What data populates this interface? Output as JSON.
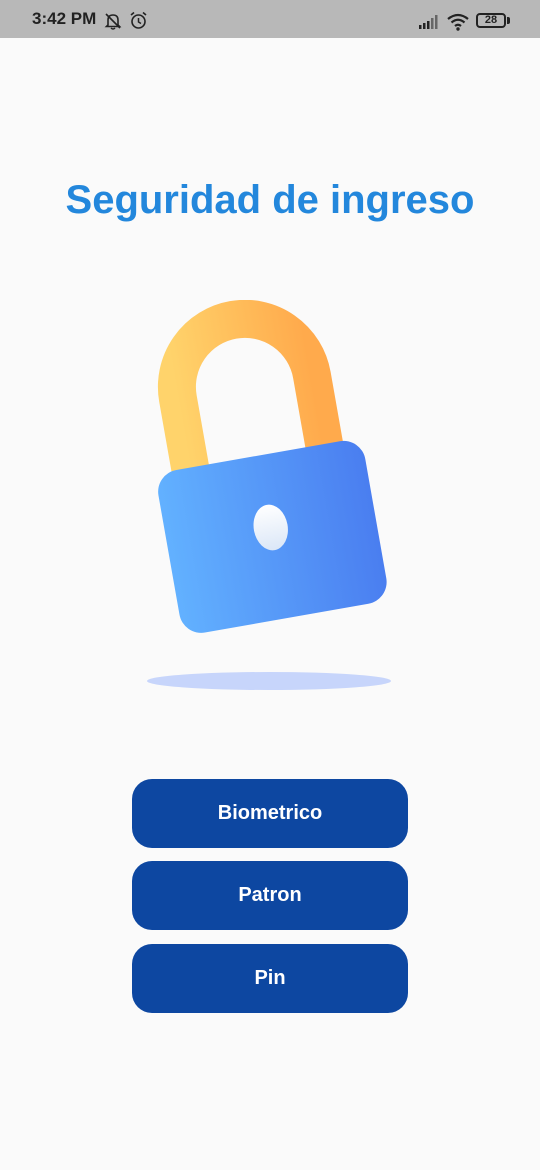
{
  "status_bar": {
    "time": "3:42 PM",
    "battery": "28",
    "icons": [
      "notifications-off-icon",
      "alarm-icon",
      "signal-icon",
      "wifi-icon",
      "battery-icon"
    ]
  },
  "title": "Seguridad de ingreso",
  "illustration": {
    "icon": "padlock-icon",
    "colors": {
      "shackle": [
        "#ffd36b",
        "#ffaa4c"
      ],
      "body": [
        "#62b1ff",
        "#4a7ef0"
      ],
      "shadow": "#c7d5fb"
    }
  },
  "buttons": [
    {
      "label": "Biometrico"
    },
    {
      "label": "Patron"
    },
    {
      "label": "Pin"
    }
  ],
  "colors": {
    "title": "#2387dc",
    "button": "#0d47a1",
    "button_text": "#ffffff",
    "background": "#fafafa",
    "status_bar": "#b8b8b8"
  }
}
